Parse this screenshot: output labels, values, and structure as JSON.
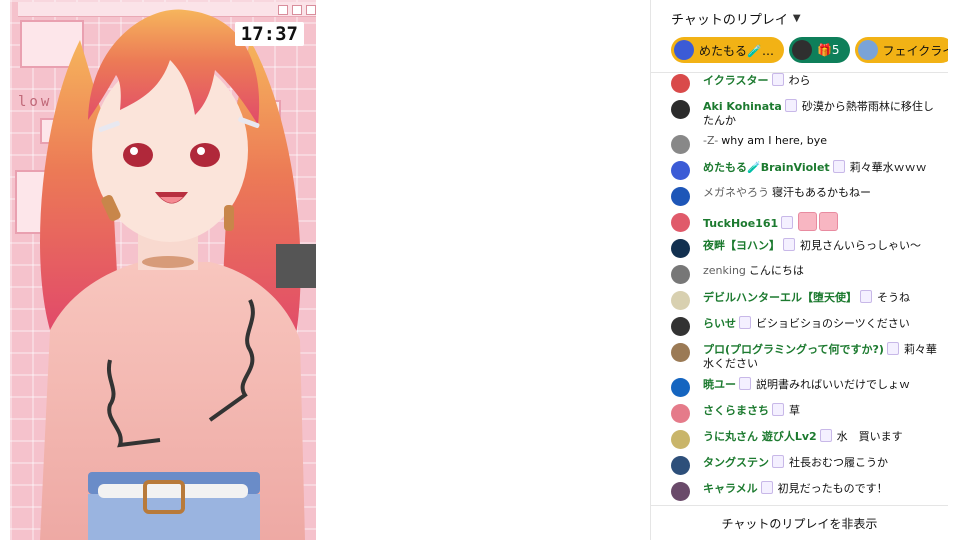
{
  "video": {
    "clock": "17:37",
    "overlay_text": "low"
  },
  "chat": {
    "header_title": "チャットのリプレイ",
    "pinned": [
      {
        "name": "めたもる🧪…",
        "color": "#f2b215"
      },
      {
        "name": "5",
        "color": "#0e7f5a"
      },
      {
        "name": "フェイクライ",
        "color": "#f2b215"
      }
    ],
    "messages": [
      {
        "author": "イクラスター",
        "text": "わら",
        "avatar_color": "#d94a4a",
        "style": "member"
      },
      {
        "author": "Aki Kohinata",
        "text": "砂漠から熱帯雨林に移住したんか",
        "avatar_color": "#2b2b2b",
        "style": "member"
      },
      {
        "author": "-Z-",
        "text": "why am I here, bye",
        "avatar_color": "#888888",
        "style": "plain"
      },
      {
        "author": "めたもる🧪BrainViolet",
        "text": "莉々華水ｗｗｗ",
        "avatar_color": "#3b5bd6",
        "style": "member"
      },
      {
        "author": "メガネやろう",
        "text": "寝汗もあるかもねー",
        "avatar_color": "#1e56b8",
        "style": "plain"
      },
      {
        "author": "TuckHoe161",
        "text": "",
        "avatar_color": "#e05a6a",
        "style": "member",
        "emojis": 2
      },
      {
        "author": "夜畔【ヨハン】",
        "text": "初見さんいらっしゃい〜",
        "avatar_color": "#12304f",
        "style": "member"
      },
      {
        "author": "zenking",
        "text": "こんにちは",
        "avatar_color": "#777777",
        "style": "plain"
      },
      {
        "author": "デビルハンターエル【堕天使】",
        "text": "そうね",
        "avatar_color": "#d8d0b0",
        "style": "member"
      },
      {
        "author": "らいせ",
        "text": "ビショビショのシーツください",
        "avatar_color": "#333333",
        "style": "member"
      },
      {
        "author": "プロ(プログラミングって何ですか?)",
        "text": "莉々華水ください",
        "avatar_color": "#9b7a55",
        "style": "member"
      },
      {
        "author": "暁ユー",
        "text": "説明書みればいいだけでしょｗ",
        "avatar_color": "#1565c0",
        "style": "member"
      },
      {
        "author": "さくらまさち",
        "text": "草",
        "avatar_color": "#e57b8a",
        "style": "member"
      },
      {
        "author": "うに丸さん 遊び人Lv2",
        "text": "水　買います",
        "avatar_color": "#c9b56a",
        "style": "member"
      },
      {
        "author": "タングステン",
        "text": "社長おむつ履こうか",
        "avatar_color": "#2d4f7a",
        "style": "member"
      },
      {
        "author": "キャラメル",
        "text": "初見だったものです！",
        "avatar_color": "#6a4a6a",
        "style": "member"
      }
    ],
    "footer_label": "チャットのリプレイを非表示"
  }
}
